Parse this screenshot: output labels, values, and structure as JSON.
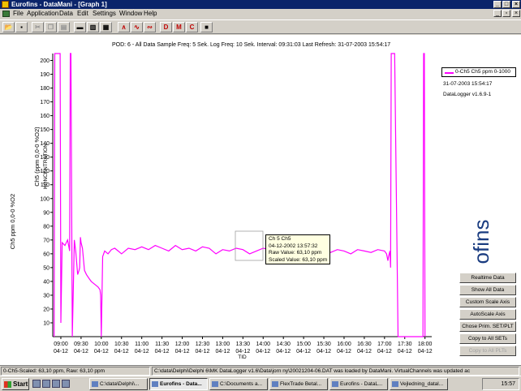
{
  "window": {
    "title": "Eurofins - DataMani - [Graph 1]"
  },
  "menu": [
    "File",
    "Application",
    "Data",
    "Edit",
    "Settings",
    "Window",
    "Help"
  ],
  "toolbar": {
    "buttons": [
      "open",
      "save",
      "cut",
      "copy",
      "paste",
      "print",
      "tile-h",
      "tile-v",
      "cascade",
      "chart-a",
      "chart-b",
      "chart-c",
      "D",
      "M",
      "C",
      "stop"
    ]
  },
  "chart_header": "POD: 6 - All Data   Sample Freq: 5 Sek.   Log Freq: 10 Sek.   Interval: 09:31:03   Last Refresh: 31-07-2003 15:54:17",
  "legend": {
    "series_label": "0-Ch5 Ch5 ppm 0-1000",
    "date": "31-07-2003 15:54:17",
    "version": "DataLogger v1.6.9-1"
  },
  "logo_text": "ofins",
  "chart_data": {
    "type": "line",
    "title": "",
    "xlabel": "TID",
    "ylabel": "Ch5 ppm 0,0-0 %O2",
    "ylabel2": "Ch5 (ppm 0,0-0 %O2)",
    "ylabel3": "KONCENTRATION",
    "ylim": [
      0,
      205
    ],
    "yticks": [
      10,
      20,
      30,
      40,
      50,
      60,
      70,
      80,
      90,
      100,
      110,
      120,
      130,
      140,
      150,
      160,
      170,
      180,
      190,
      200
    ],
    "xticks": [
      {
        "time": "09:00",
        "date": "04-12"
      },
      {
        "time": "09:30",
        "date": "04-12"
      },
      {
        "time": "10:00",
        "date": "04-12"
      },
      {
        "time": "10:30",
        "date": "04-12"
      },
      {
        "time": "11:00",
        "date": "04-12"
      },
      {
        "time": "11:30",
        "date": "04-12"
      },
      {
        "time": "12:00",
        "date": "04-12"
      },
      {
        "time": "12:30",
        "date": "04-12"
      },
      {
        "time": "13:00",
        "date": "04-12"
      },
      {
        "time": "13:30",
        "date": "04-12"
      },
      {
        "time": "14:00",
        "date": "04-12"
      },
      {
        "time": "14:30",
        "date": "04-12"
      },
      {
        "time": "15:00",
        "date": "04-12"
      },
      {
        "time": "15:30",
        "date": "04-12"
      },
      {
        "time": "16:00",
        "date": "04-12"
      },
      {
        "time": "16:30",
        "date": "04-12"
      },
      {
        "time": "17:00",
        "date": "04-12"
      },
      {
        "time": "17:30",
        "date": "04-12"
      },
      {
        "time": "18:00",
        "date": "04-12"
      }
    ],
    "series": [
      {
        "name": "0-Ch5 Ch5 ppm 0-1000",
        "color": "#ff00ff",
        "x": [
          "08:50",
          "08:51",
          "08:53",
          "08:56",
          "08:59",
          "09:00",
          "09:02",
          "09:06",
          "09:10",
          "09:13",
          "09:14",
          "09:15",
          "09:17",
          "09:20",
          "09:22",
          "09:25",
          "09:27",
          "09:28",
          "09:29",
          "09:30",
          "09:32",
          "09:35",
          "09:38",
          "09:42",
          "09:45",
          "09:50",
          "09:55",
          "09:58",
          "09:59",
          "10:00",
          "10:02",
          "10:05",
          "10:10",
          "10:15",
          "10:20",
          "10:25",
          "10:30",
          "10:40",
          "10:50",
          "11:00",
          "11:10",
          "11:20",
          "11:30",
          "11:40",
          "11:50",
          "12:00",
          "12:10",
          "12:20",
          "12:30",
          "12:40",
          "12:50",
          "13:00",
          "13:10",
          "13:20",
          "13:30",
          "13:40",
          "13:50",
          "14:00",
          "14:10",
          "14:20",
          "14:30",
          "14:40",
          "14:50",
          "15:00",
          "15:10",
          "15:20",
          "15:30",
          "15:40",
          "15:50",
          "16:00",
          "16:10",
          "16:20",
          "16:30",
          "16:40",
          "16:50",
          "17:00",
          "17:03",
          "17:05",
          "17:06",
          "17:08",
          "17:09",
          "17:10",
          "17:11",
          "17:15",
          "17:20",
          "17:25",
          "17:30",
          "17:35",
          "17:38",
          "17:40",
          "17:42",
          "17:45",
          "17:50",
          "17:55",
          "17:57",
          "17:58",
          "17:59",
          "18:00"
        ],
        "y": [
          0,
          205,
          205,
          205,
          205,
          10,
          68,
          66,
          70,
          62,
          205,
          205,
          0,
          70,
          62,
          45,
          48,
          50,
          72,
          68,
          64,
          48,
          45,
          42,
          40,
          38,
          36,
          34,
          30,
          0,
          58,
          62,
          60,
          63,
          64,
          62,
          60,
          64,
          63,
          65,
          63,
          66,
          64,
          62,
          66,
          63,
          64,
          62,
          65,
          64,
          60,
          63,
          62,
          64,
          63,
          60,
          62,
          64,
          63,
          62,
          64,
          62,
          61,
          63,
          61,
          62,
          64,
          61,
          63,
          62,
          60,
          63,
          62,
          61,
          63,
          62,
          60,
          55,
          58,
          62,
          50,
          205,
          205,
          205,
          0,
          0,
          0,
          0,
          0,
          0,
          0,
          0,
          0,
          0,
          0,
          205,
          205,
          0
        ]
      }
    ],
    "grid": false,
    "legend_position": "top-right"
  },
  "tooltip": {
    "line1": "Ch 5 Ch5",
    "line2": "04-12-2002 13:57:32",
    "line3": "Raw Value: 63,10 ppm",
    "line4": "Scaled Value: 63,10 ppm"
  },
  "side_buttons": [
    {
      "label": "Realtime Data",
      "enabled": true
    },
    {
      "label": "Show All Data",
      "enabled": true
    },
    {
      "label": "Custom Scale Axis",
      "enabled": true
    },
    {
      "label": "AutoScale Axis",
      "enabled": true
    },
    {
      "label": "Chose Prim. SET/PLT",
      "enabled": true
    },
    {
      "label": "Copy to All SETs",
      "enabled": true
    },
    {
      "label": "Copy to All PLTs",
      "enabled": false
    }
  ],
  "status": {
    "left": "0-Ch5-Scaled: 63,10 ppm, Raw: 63,10 ppm",
    "right": "C:\\data\\Delphi\\Delphi 6\\MK DataLogger v1.6\\Data\\jorn ny\\20021204-06.DAT was loaded by DataMani.  VirtualChannels was updated ac"
  },
  "taskbar": {
    "start": "Start",
    "tasks": [
      {
        "label": "C:\\data\\Delphi\\...",
        "active": false
      },
      {
        "label": "Eurofins - Data...",
        "active": true
      },
      {
        "label": "C:\\Documents a...",
        "active": false
      },
      {
        "label": "FlexTrade Betal...",
        "active": false
      },
      {
        "label": "Eurofins - DataL...",
        "active": false
      },
      {
        "label": "Vejledning_datal...",
        "active": false
      }
    ],
    "clock": "15:57"
  }
}
